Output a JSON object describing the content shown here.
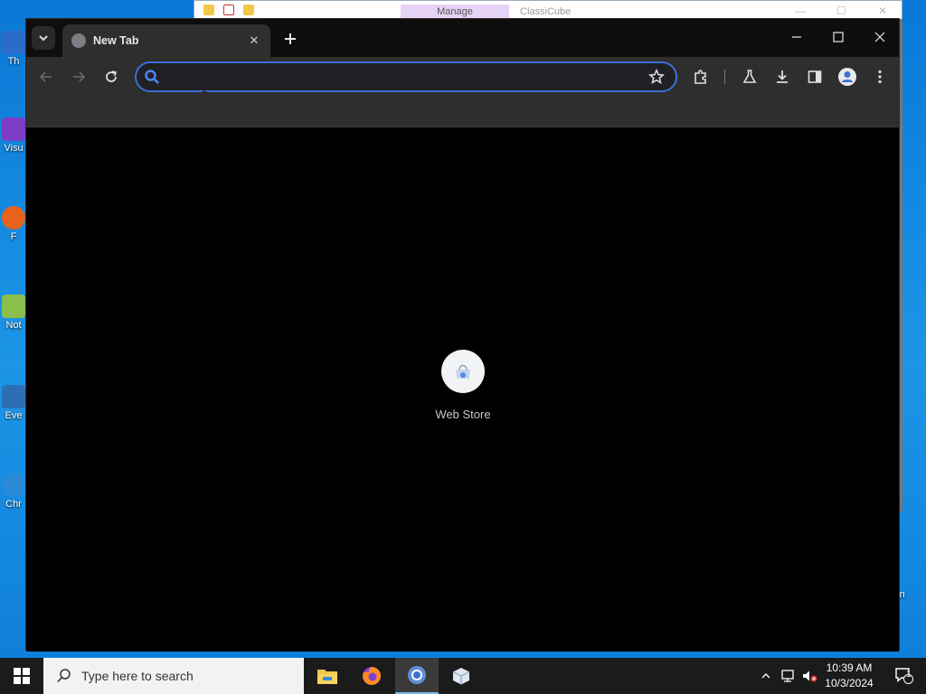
{
  "desktop": {
    "icons": [
      {
        "label": "Th",
        "color": "#2a6cc7"
      },
      {
        "label": "Visu",
        "color": "#7d3cc6"
      },
      {
        "label": "F",
        "color": "#e8621c"
      },
      {
        "label": "Not",
        "color": "#8bbf4c"
      },
      {
        "label": "Eve",
        "color": "#2d6fb5"
      },
      {
        "label": "Chr",
        "color": "#2a8ad8"
      }
    ],
    "right_label": "in"
  },
  "explorer": {
    "manage_tab": "Manage",
    "title": "ClassiCube"
  },
  "browser": {
    "tab_title": "New Tab",
    "omnibox": {
      "value": "",
      "placeholder": ""
    },
    "shortcut": {
      "label": "Web Store",
      "icon": "webstore-icon"
    },
    "colors": {
      "accent": "#3d6ed8",
      "toolbar": "#2e2e2e",
      "titlebar": "#0e0e0e"
    }
  },
  "taskbar": {
    "search_placeholder": "Type here to search",
    "apps": [
      "file-explorer-icon",
      "firefox-icon",
      "chrome-icon",
      "package-icon"
    ],
    "clock_time": "10:39 AM",
    "clock_date": "10/3/2024",
    "notification_count": "1"
  }
}
